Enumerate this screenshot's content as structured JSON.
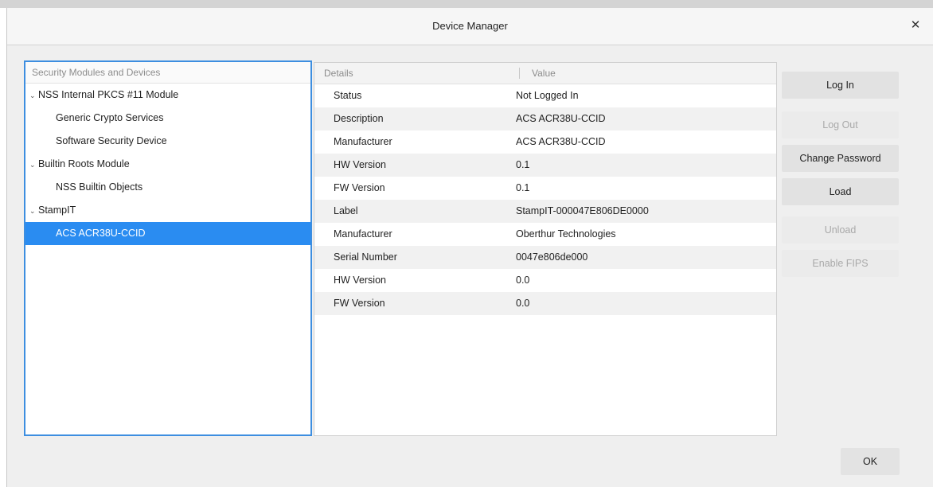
{
  "dialog": {
    "title": "Device Manager",
    "close_glyph": "✕",
    "ok_label": "OK"
  },
  "tree": {
    "header": "Security Modules and Devices",
    "items": [
      {
        "label": "NSS Internal PKCS #11 Module",
        "level": 0,
        "expanded": true,
        "twisty": "⌄"
      },
      {
        "label": "Generic Crypto Services",
        "level": 1
      },
      {
        "label": "Software Security Device",
        "level": 1
      },
      {
        "label": "Builtin Roots Module",
        "level": 0,
        "expanded": true,
        "twisty": "⌄"
      },
      {
        "label": "NSS Builtin Objects",
        "level": 1
      },
      {
        "label": "StampIT",
        "level": 0,
        "expanded": true,
        "twisty": "⌄"
      },
      {
        "label": "ACS ACR38U-CCID",
        "level": 1,
        "selected": true
      }
    ]
  },
  "details": {
    "columns": [
      "Details",
      "Value"
    ],
    "rows": [
      {
        "key": "Status",
        "value": "Not Logged In"
      },
      {
        "key": "Description",
        "value": "ACS ACR38U-CCID"
      },
      {
        "key": "Manufacturer",
        "value": "ACS ACR38U-CCID"
      },
      {
        "key": "HW Version",
        "value": "0.1"
      },
      {
        "key": "FW Version",
        "value": "0.1"
      },
      {
        "key": "Label",
        "value": "StampIT-000047E806DE0000"
      },
      {
        "key": "Manufacturer",
        "value": "Oberthur Technologies"
      },
      {
        "key": "Serial Number",
        "value": "0047e806de000"
      },
      {
        "key": "HW Version",
        "value": "0.0"
      },
      {
        "key": "FW Version",
        "value": "0.0"
      }
    ]
  },
  "buttons": {
    "log_in": {
      "label": "Log In",
      "enabled": true
    },
    "log_out": {
      "label": "Log Out",
      "enabled": false
    },
    "change_password": {
      "label": "Change Password",
      "enabled": true
    },
    "load": {
      "label": "Load",
      "enabled": true
    },
    "unload": {
      "label": "Unload",
      "enabled": false
    },
    "enable_fips": {
      "label": "Enable FIPS",
      "enabled": false
    }
  },
  "colors": {
    "selection": "#2a8cf1",
    "focus_border": "#3d8ee0"
  }
}
